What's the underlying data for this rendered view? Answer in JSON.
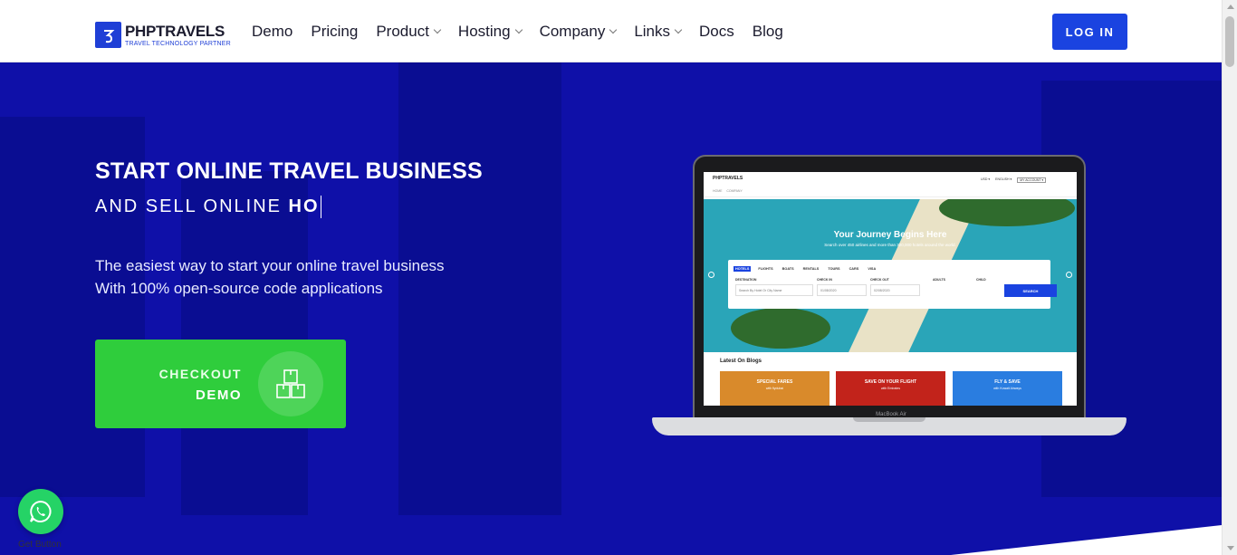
{
  "header": {
    "logo_name": "PHPTRAVELS",
    "logo_tagline": "TRAVEL TECHNOLOGY PARTNER",
    "nav": [
      {
        "label": "Demo",
        "dropdown": false
      },
      {
        "label": "Pricing",
        "dropdown": false
      },
      {
        "label": "Product",
        "dropdown": true
      },
      {
        "label": "Hosting",
        "dropdown": true
      },
      {
        "label": "Company",
        "dropdown": true
      },
      {
        "label": "Links",
        "dropdown": true
      },
      {
        "label": "Docs",
        "dropdown": false
      },
      {
        "label": "Blog",
        "dropdown": false
      }
    ],
    "login_label": "LOG IN"
  },
  "hero": {
    "title": "START ONLINE TRAVEL BUSINESS",
    "subtitle_prefix": "AND SELL ONLINE ",
    "subtitle_typed": "HO",
    "description_line1": "The easiest way to start your online travel business",
    "description_line2": "With 100% open-source code applications",
    "cta_line1": "CHECKOUT",
    "cta_line2": "DEMO"
  },
  "laptop": {
    "model_label": "MacBook Air",
    "site": {
      "logo": "PHPTRAVELS",
      "top_links": [
        "USD ▾",
        "ENGLISH ▾",
        "MY ACCOUNT ▾"
      ],
      "breadcrumb": "HOME     COMPANY",
      "hero_title": "Your Journey Begins Here",
      "hero_subtitle": "Search over 450 airlines and more than 320,000 hotels around the world.",
      "tabs": [
        "HOTELS",
        "FLIGHTS",
        "BOATS",
        "RENTALS",
        "TOURS",
        "CARS",
        "VISA"
      ],
      "labels": {
        "destination": "DESTINATION",
        "checkin": "CHECK IN",
        "checkout": "CHECK OUT",
        "adults": "ADULTS",
        "child": "CHILD"
      },
      "destination_placeholder": "Search By Hotel Or City Name",
      "checkin_value": "01/08/2020",
      "checkout_value": "02/08/2020",
      "search_label": "SEARCH",
      "blogs_heading": "Latest On Blogs",
      "cards": [
        {
          "title": "SPECIAL FARES",
          "sub": "with flydubai"
        },
        {
          "title": "SAVE ON YOUR FLIGHT",
          "sub": "with Emirates"
        },
        {
          "title": "FLY & SAVE",
          "sub": "with Kuwait Airways"
        }
      ]
    }
  },
  "whatsapp": {
    "label": "Get Button"
  },
  "colors": {
    "brand_blue": "#1a43e0",
    "hero_bg": "#0f10a8",
    "cta_green": "#2fcd3c",
    "whatsapp_green": "#25d366"
  }
}
